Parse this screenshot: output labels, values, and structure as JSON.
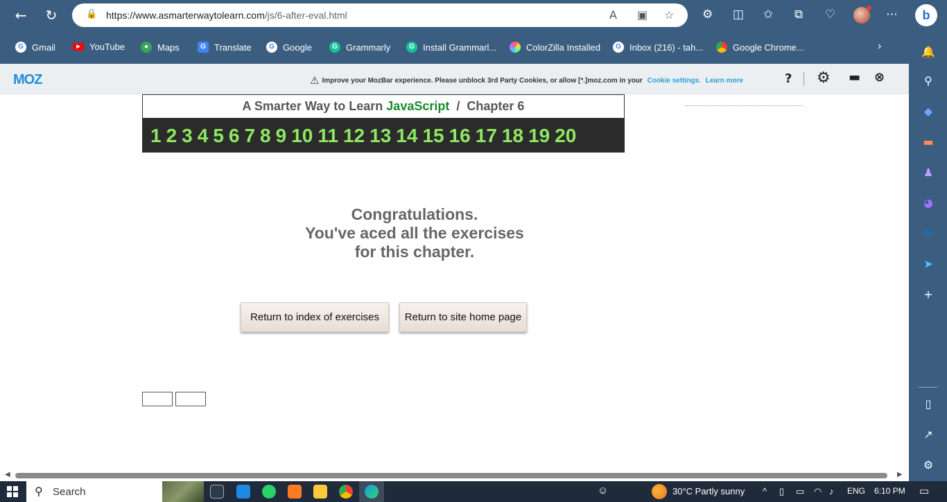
{
  "browser": {
    "url_host": "https://www.asmarterwaytolearn.com",
    "url_path": "/js/6-after-eval.html"
  },
  "bookmarks": [
    {
      "label": "Gmail",
      "icon": "google-icon",
      "color": "#ffffff"
    },
    {
      "label": "YouTube",
      "icon": "youtube-icon",
      "color": "#ff0000"
    },
    {
      "label": "Maps",
      "icon": "maps-icon",
      "color": "#34a853"
    },
    {
      "label": "Translate",
      "icon": "translate-icon",
      "color": "#4285f4"
    },
    {
      "label": "Google",
      "icon": "google-icon",
      "color": "#ffffff"
    },
    {
      "label": "Grammarly",
      "icon": "grammarly-icon",
      "color": "#15c39a"
    },
    {
      "label": "Install Grammarl...",
      "icon": "grammarly-icon",
      "color": "#15c39a"
    },
    {
      "label": "ColorZilla Installed",
      "icon": "colorzilla-icon",
      "color": "#c86bff"
    },
    {
      "label": "Inbox (216) - tah...",
      "icon": "google-icon",
      "color": "#ffffff"
    },
    {
      "label": "Google Chrome...",
      "icon": "chrome-icon",
      "color": "#fbbc04"
    }
  ],
  "mozbar": {
    "logo": "MOZ",
    "message": "Improve your MozBar experience. Please unblock 3rd Party Cookies, or allow [*.]moz.com in your",
    "cookie_link": "Cookie settings.",
    "learn_link": "Learn more",
    "help": "?"
  },
  "page": {
    "header_prefix": "A Smarter Way to Learn",
    "header_js": "JavaScript",
    "header_sep": "/",
    "header_chapter": "Chapter 6",
    "numbers": [
      "1",
      "2",
      "3",
      "4",
      "5",
      "6",
      "7",
      "8",
      "9",
      "10",
      "11",
      "12",
      "13",
      "14",
      "15",
      "16",
      "17",
      "18",
      "19",
      "20"
    ],
    "congrats_line1": "Congratulations.",
    "congrats_line2": "You've aced all the exercises",
    "congrats_line3": "for this chapter.",
    "btn_index": "Return to index of exercises",
    "btn_home": "Return to site home page"
  },
  "taskbar": {
    "search": "Search",
    "weather": "30°C  Partly sunny",
    "lang": "ENG",
    "time": "6:10 PM"
  }
}
